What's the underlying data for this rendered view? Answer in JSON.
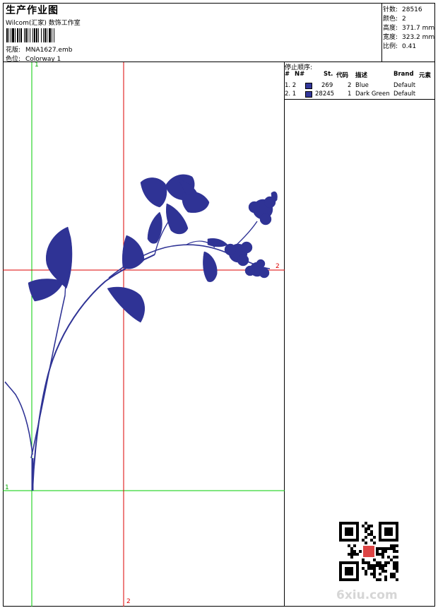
{
  "header": {
    "title": "生产作业图",
    "subtitle": "Wilcom(汇家) 数饰工作室",
    "pattern_label": "花版:",
    "pattern_value": "MNA1627.emb",
    "colorway_label": "色位:",
    "colorway_value": "Colorway 1"
  },
  "stats": [
    {
      "label": "针数:",
      "value": "28516"
    },
    {
      "label": "颜色:",
      "value": "2"
    },
    {
      "label": "高度:",
      "value": "371.7 mm"
    },
    {
      "label": "宽度:",
      "value": "323.2 mm"
    },
    {
      "label": "比例:",
      "value": "0.41"
    }
  ],
  "stop_sequence": {
    "title": "停止顺序:",
    "columns": [
      "#",
      "N#",
      "St.",
      "代码",
      "描述",
      "Brand",
      "元素"
    ],
    "rows": [
      {
        "num": "1. 2",
        "stitches": "269",
        "code": "2",
        "desc": "Blue",
        "brand": "Default",
        "color": "#33379a"
      },
      {
        "num": "2. 1",
        "stitches": "28245",
        "code": "1",
        "desc": "Dark Green",
        "brand": "Default",
        "color": "#33379a"
      }
    ]
  },
  "axes": {
    "green_v_top": "1",
    "green_h_left": "1",
    "red_h_right": "2",
    "red_v_bottom": "2"
  },
  "colors": {
    "embroidery": "#2f3395",
    "green_line": "#00cc00",
    "red_line": "#dd0000",
    "watermark": "#d9d9d9"
  },
  "watermark": "6xiu.com"
}
